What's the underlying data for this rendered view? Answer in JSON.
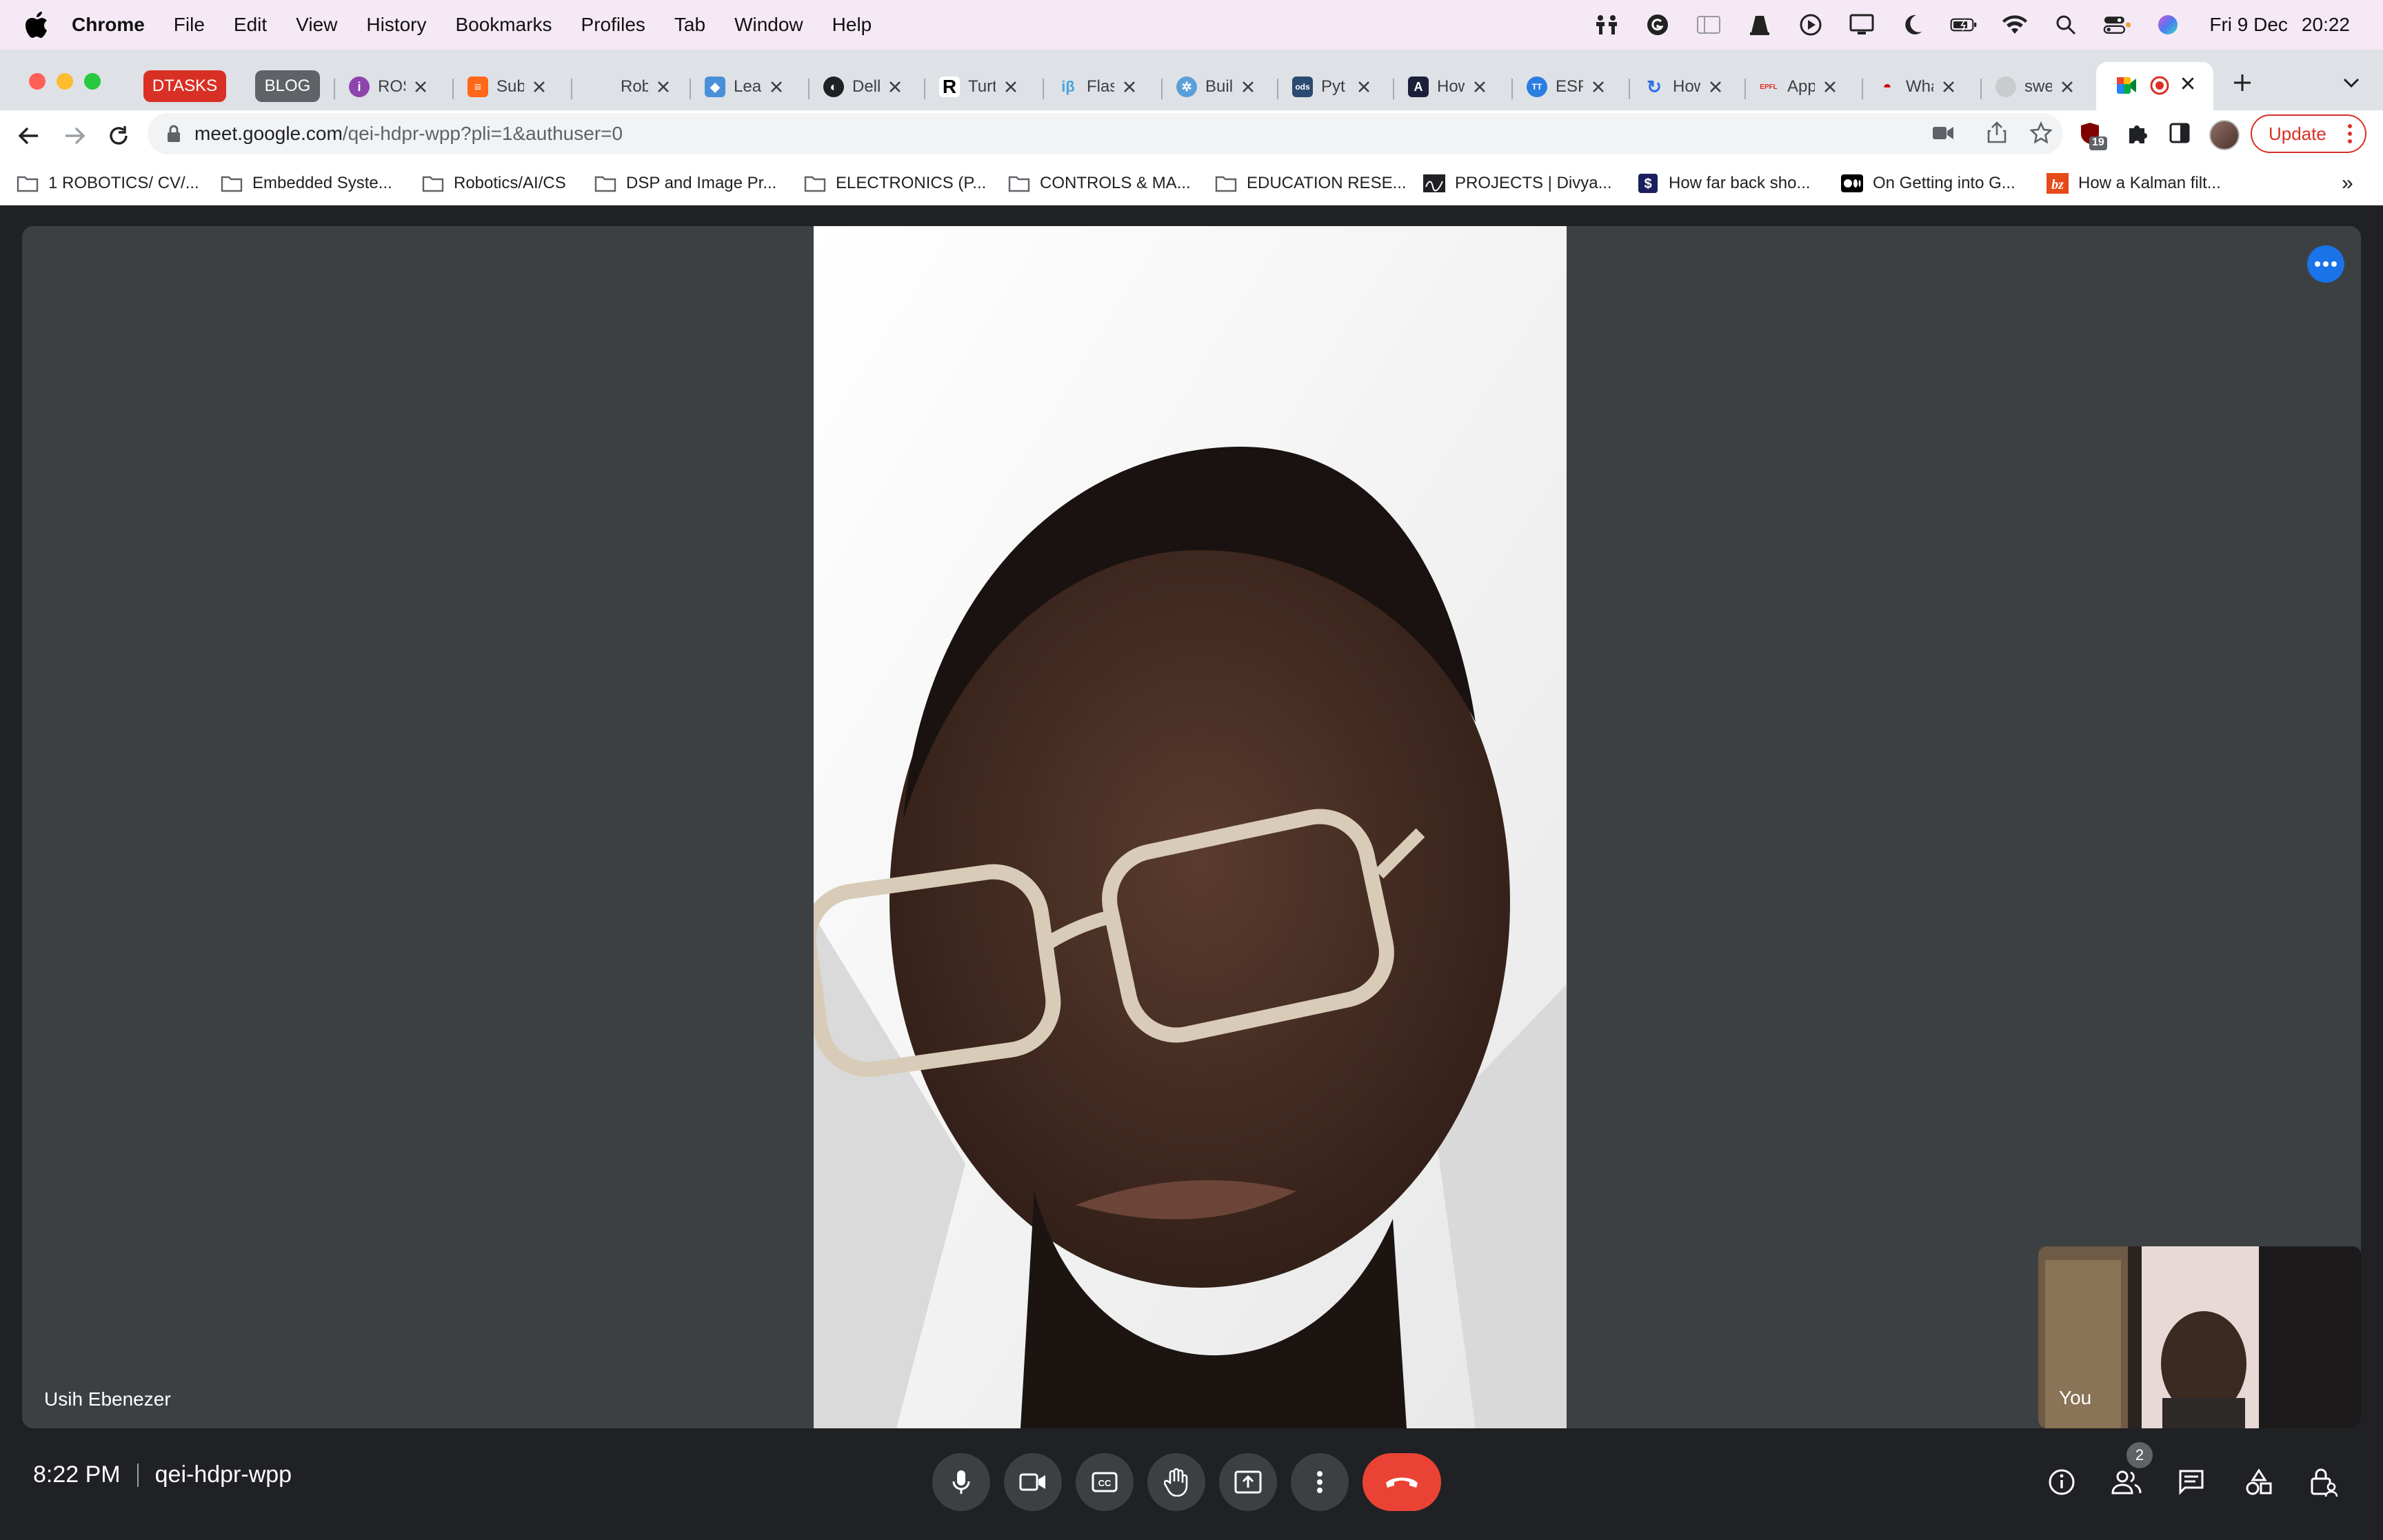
{
  "menubar": {
    "app_name": "Chrome",
    "items": [
      "File",
      "Edit",
      "View",
      "History",
      "Bookmarks",
      "Profiles",
      "Tab",
      "Window",
      "Help"
    ],
    "date": "Fri 9 Dec",
    "time": "20:22"
  },
  "tabs": {
    "groups": [
      {
        "label": "DTASKS",
        "color": "#d93025"
      },
      {
        "label": "BLOG",
        "color": "#5f6368"
      }
    ],
    "items": [
      "ROS",
      "Sub",
      "Rob",
      "Lea",
      "Dell",
      "Turt",
      "Flas",
      "Buil",
      "Pyt",
      "How",
      "ESP",
      "How",
      "App",
      "Wha",
      "swe",
      ""
    ]
  },
  "toolbar": {
    "url_domain": "meet.google.com",
    "url_path": "/qei-hdpr-wpp?pli=1&authuser=0",
    "extension_badge": "19",
    "update_label": "Update"
  },
  "bookmarks": [
    "1 ROBOTICS/ CV/...",
    "Embedded Syste...",
    "Robotics/AI/CS",
    "DSP and Image Pr...",
    "ELECTRONICS (P...",
    "CONTROLS & MA...",
    "EDUCATION RESE...",
    "PROJECTS | Divya...",
    "How far back sho...",
    "On Getting into G...",
    "How a Kalman filt...",
    "»"
  ],
  "meet": {
    "remote_participant": "Usih Ebenezer",
    "self_label": "You",
    "time": "8:22 PM",
    "meeting_code": "qei-hdpr-wpp",
    "participant_count": "2",
    "colors": {
      "hangup": "#ea4335",
      "options_button": "#1a73e8",
      "stage": "#3c4043"
    }
  }
}
